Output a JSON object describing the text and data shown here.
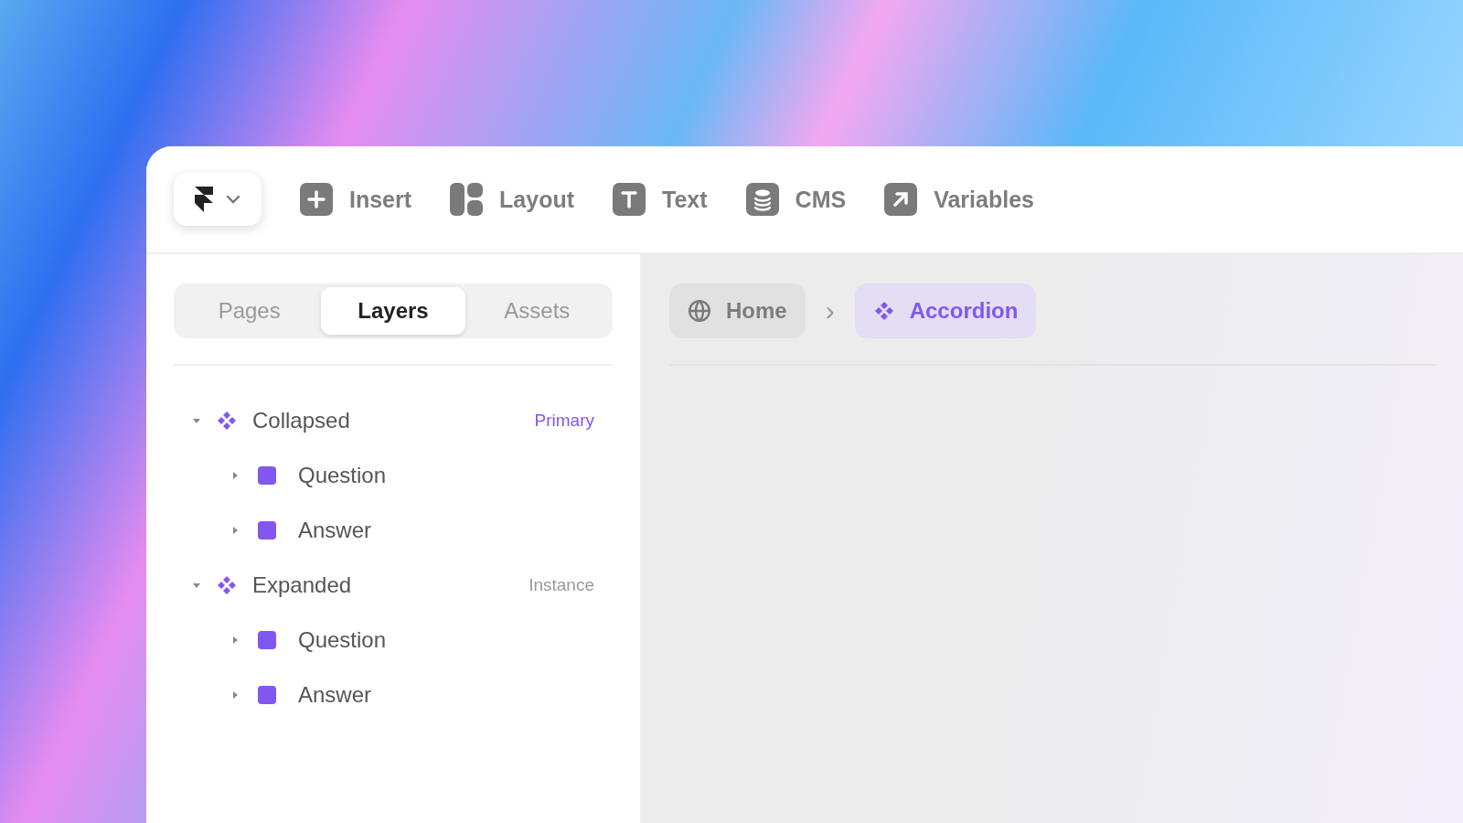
{
  "toolbar": {
    "menu_open": false,
    "items": [
      {
        "label": "Insert"
      },
      {
        "label": "Layout"
      },
      {
        "label": "Text"
      },
      {
        "label": "CMS"
      },
      {
        "label": "Variables"
      }
    ]
  },
  "tabs": [
    {
      "label": "Pages",
      "selected": false
    },
    {
      "label": "Layers",
      "selected": true
    },
    {
      "label": "Assets",
      "selected": false
    }
  ],
  "layers": [
    {
      "name": "Collapsed",
      "kind": "component",
      "expanded": true,
      "tag": {
        "text": "Primary",
        "kind": "primary"
      },
      "children": [
        {
          "name": "Question",
          "kind": "frame",
          "expanded": false
        },
        {
          "name": "Answer",
          "kind": "frame",
          "expanded": false
        }
      ]
    },
    {
      "name": "Expanded",
      "kind": "component",
      "expanded": true,
      "tag": {
        "text": "Instance",
        "kind": "instance"
      },
      "children": [
        {
          "name": "Question",
          "kind": "frame",
          "expanded": false
        },
        {
          "name": "Answer",
          "kind": "frame",
          "expanded": false
        }
      ]
    }
  ],
  "breadcrumb": {
    "separator": "›",
    "items": [
      {
        "label": "Home",
        "kind": "page",
        "selected": false
      },
      {
        "label": "Accordion",
        "kind": "component",
        "selected": true
      }
    ]
  }
}
